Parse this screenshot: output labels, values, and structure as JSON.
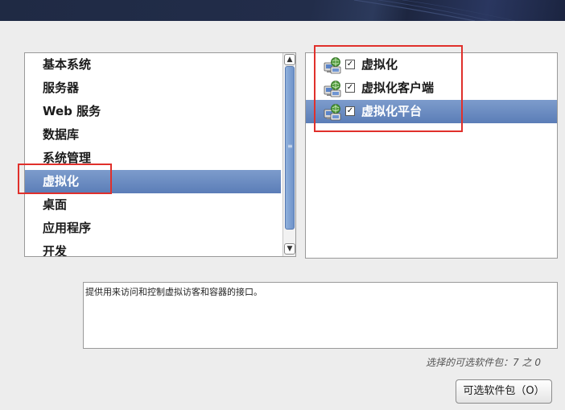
{
  "categories": [
    {
      "label": "基本系统",
      "selected": false
    },
    {
      "label": "服务器",
      "selected": false
    },
    {
      "label": "Web 服务",
      "selected": false
    },
    {
      "label": "数据库",
      "selected": false
    },
    {
      "label": "系统管理",
      "selected": false
    },
    {
      "label": "虚拟化",
      "selected": true
    },
    {
      "label": "桌面",
      "selected": false
    },
    {
      "label": "应用程序",
      "selected": false
    },
    {
      "label": "开发",
      "selected": false
    }
  ],
  "packages": [
    {
      "label": "虚拟化",
      "checked": true,
      "selected": false
    },
    {
      "label": "虚拟化客户端",
      "checked": true,
      "selected": false
    },
    {
      "label": "虚拟化平台",
      "checked": true,
      "selected": true
    }
  ],
  "description": "提供用来访问和控制虚拟访客和容器的接口。",
  "selected_count": "选择的可选软件包：7 之 0",
  "optional_button": {
    "label": "可选软件包（O）"
  },
  "icons": {
    "scroll_up": "arrow-up-icon",
    "scroll_down": "arrow-down-icon",
    "package": "computer-network-icon",
    "checkbox": "checkmark-icon"
  },
  "colors": {
    "selection": "#6b8cc2",
    "highlight": "#e0302b",
    "banner": "#1f2a44"
  }
}
